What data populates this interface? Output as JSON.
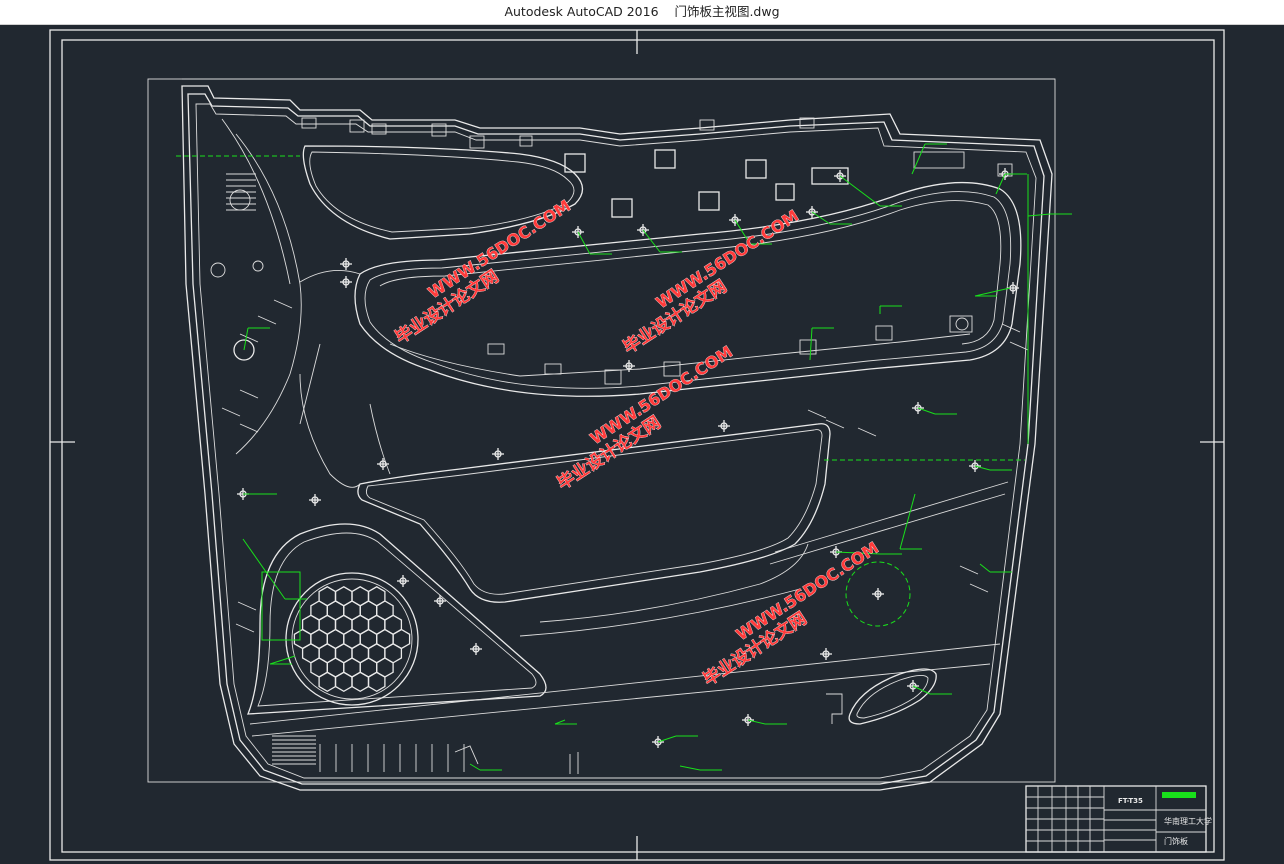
{
  "window": {
    "app_title": "Autodesk AutoCAD 2016",
    "file_name": "门饰板主视图.dwg"
  },
  "watermarks": [
    {
      "site": "WWW.56DOC.COM",
      "name": "毕业设计论文网"
    },
    {
      "site": "WWW.56DOC.COM",
      "name": "毕业设计论文网"
    },
    {
      "site": "WWW.56DOC.COM",
      "name": "毕业设计论文网"
    },
    {
      "site": "WWW.56DOC.COM",
      "name": "毕业设计论文网"
    }
  ],
  "title_block": {
    "code": "FT-T35",
    "school": "华南理工大学",
    "part_name": "门饰板"
  },
  "colors": {
    "background": "#212830",
    "linework": "#e9e9e9",
    "annotation": "#19e01b",
    "watermark": "#ff3b3b"
  }
}
